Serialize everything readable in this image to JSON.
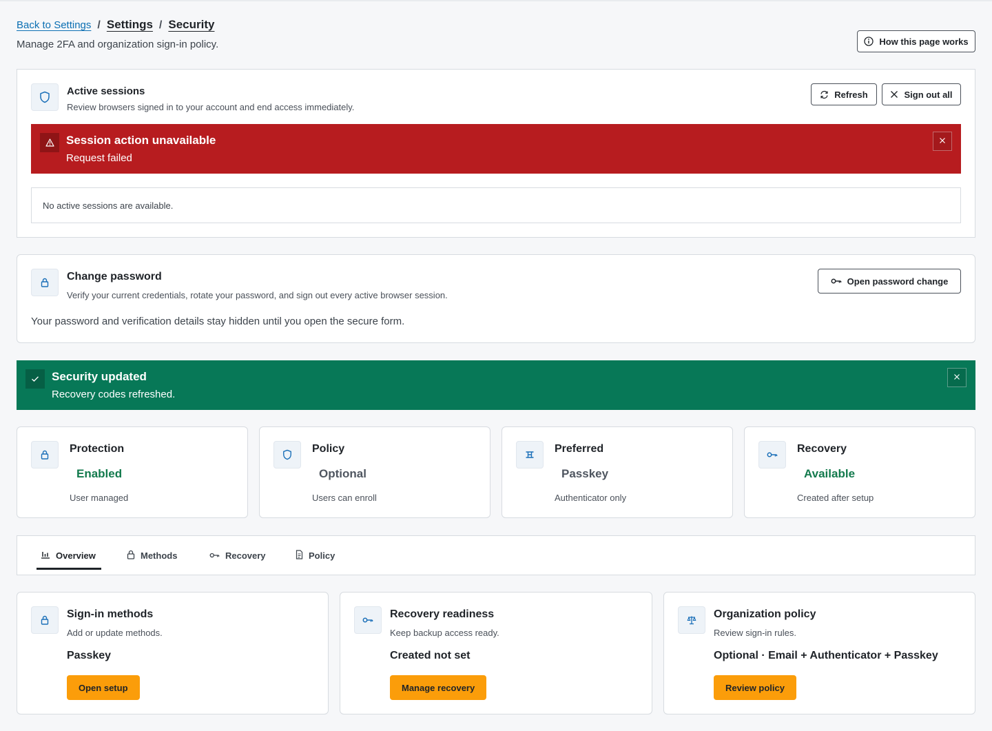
{
  "header": {
    "back_link": "Back to Settings",
    "crumb_settings": "Settings",
    "crumb_security": "Security",
    "separator": "/",
    "subtitle": "Manage 2FA and organization sign-in policy.",
    "help_button": "How this page works"
  },
  "sessions": {
    "title": "Active sessions",
    "description": "Review browsers signed in to your account and end access immediately.",
    "refresh_label": "Refresh",
    "signout_all_label": "Sign out all",
    "error": {
      "title": "Session action unavailable",
      "message": "Request failed"
    },
    "empty_text": "No active sessions are available."
  },
  "password": {
    "title": "Change password",
    "description": "Verify your current credentials, rotate your password, and sign out every active browser session.",
    "button_label": "Open password change",
    "note": "Your password and verification details stay hidden until you open the secure form."
  },
  "success": {
    "title": "Security updated",
    "message": "Recovery codes refreshed."
  },
  "stats": [
    {
      "title": "Protection",
      "value": "Enabled",
      "note": "User managed",
      "icon": "lock-icon",
      "tone": "green"
    },
    {
      "title": "Policy",
      "value": "Optional",
      "note": "Users can enroll",
      "icon": "shield-icon",
      "tone": "grey"
    },
    {
      "title": "Preferred",
      "value": "Passkey",
      "note": "Authenticator only",
      "icon": "passkey-icon",
      "tone": "grey"
    },
    {
      "title": "Recovery",
      "value": "Available",
      "note": "Created after setup",
      "icon": "key-icon",
      "tone": "green"
    }
  ],
  "tabs": [
    {
      "label": "Overview",
      "icon": "bar-chart-icon",
      "active": true
    },
    {
      "label": "Methods",
      "icon": "lock-icon",
      "active": false
    },
    {
      "label": "Recovery",
      "icon": "key-icon",
      "active": false
    },
    {
      "label": "Policy",
      "icon": "document-icon",
      "active": false
    }
  ],
  "cards": [
    {
      "title": "Sign-in methods",
      "description": "Add or update methods.",
      "value": "Passkey",
      "button": "Open setup",
      "icon": "lock-icon"
    },
    {
      "title": "Recovery readiness",
      "description": "Keep backup access ready.",
      "value": "Created not set",
      "button": "Manage recovery",
      "icon": "key-icon"
    },
    {
      "title": "Organization policy",
      "description": "Review sign-in rules.",
      "value": "Optional · Email + Authenticator + Passkey",
      "button": "Review policy",
      "icon": "scale-icon"
    }
  ],
  "colors": {
    "error_bg": "#b71c1f",
    "success_bg": "#077857",
    "accent_orange": "#fb9d0a",
    "link_blue": "#0b6fb3",
    "status_green": "#137a4d"
  }
}
